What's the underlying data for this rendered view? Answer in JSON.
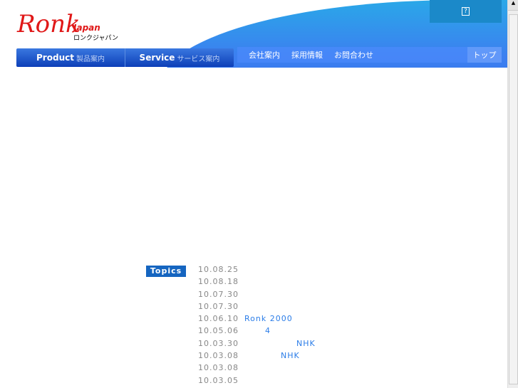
{
  "logo": {
    "name": "Ronk",
    "sub": "Japan",
    "kana": "ロンクジャパン"
  },
  "help": {
    "label": "?"
  },
  "main_nav": [
    {
      "en": "Product",
      "jp": "製品案内"
    },
    {
      "en": "Service",
      "jp": "サービス案内"
    }
  ],
  "sub_nav": [
    "会社案内",
    "採用情報",
    "お問合わせ"
  ],
  "top_link": "トップ",
  "topics": {
    "label": "Topics",
    "items": [
      {
        "date": "10.08.25",
        "text": ""
      },
      {
        "date": "10.08.18",
        "text": ""
      },
      {
        "date": "10.07.30",
        "text": ""
      },
      {
        "date": "10.07.30",
        "text": ""
      },
      {
        "date": "10.06.10",
        "text": "Ronk 2000"
      },
      {
        "date": "10.05.06",
        "text": "4"
      },
      {
        "date": "10.03.30",
        "text": "NHK"
      },
      {
        "date": "10.03.08",
        "text": "NHK"
      },
      {
        "date": "10.03.08",
        "text": ""
      },
      {
        "date": "10.03.05",
        "text": ""
      }
    ]
  }
}
